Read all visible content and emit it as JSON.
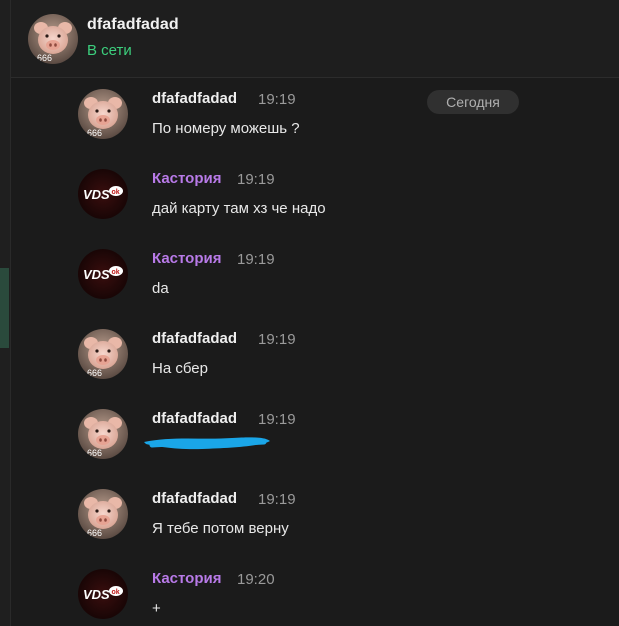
{
  "header": {
    "name": "dfafadfadad",
    "status": "В сети",
    "avatar_icon": "pig-avatar-icon"
  },
  "date_divider": "Сегодня",
  "avatar_tag": "666",
  "vds_logo_text": "VDS",
  "vds_logo_badge": "ok",
  "colors": {
    "background": "#1b1b1b",
    "status_online": "#3ccf7d",
    "author_kastoria": "#b87ae8",
    "author_pig": "#eeeeee",
    "scribble": "#1aa6e8"
  },
  "messages": [
    {
      "author": "dfafadfadad",
      "time": "19:19",
      "text": "По номеру можешь ?",
      "avatar": "pig"
    },
    {
      "author": "Кастория",
      "time": "19:19",
      "text": "дай карту там хз че надо",
      "avatar": "vds"
    },
    {
      "author": "Кастория",
      "time": "19:19",
      "text": "da",
      "avatar": "vds"
    },
    {
      "author": "dfafadfadad",
      "time": "19:19",
      "text": "На сбер",
      "avatar": "pig"
    },
    {
      "author": "dfafadfadad",
      "time": "19:19",
      "text": "",
      "avatar": "pig",
      "redacted": true
    },
    {
      "author": "dfafadfadad",
      "time": "19:19",
      "text": "Я тебе потом верну",
      "avatar": "pig"
    },
    {
      "author": "Кастория",
      "time": "19:20",
      "text": "+",
      "avatar": "vds"
    }
  ]
}
